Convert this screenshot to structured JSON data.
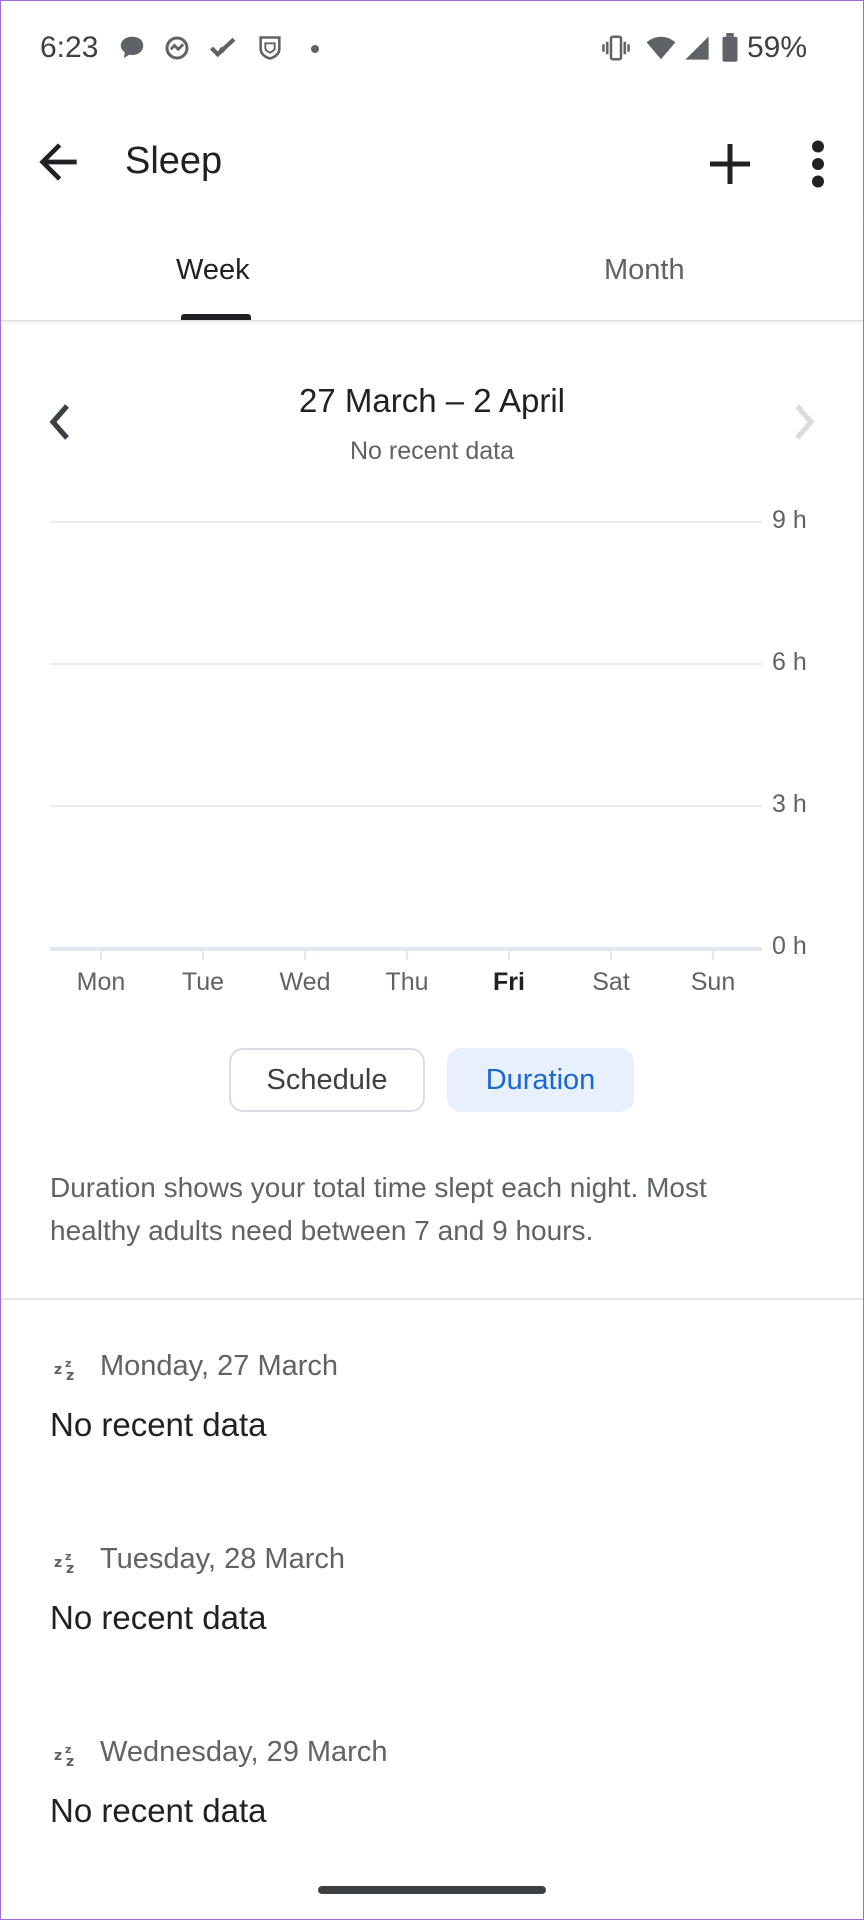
{
  "status_bar": {
    "time": "6:23",
    "battery": "59%",
    "icons": [
      "chat-icon",
      "fitness-icon",
      "tasks-icon",
      "shield-icon",
      "dot-icon",
      "vibrate-icon",
      "wifi-icon",
      "signal-icon",
      "battery-icon"
    ]
  },
  "app_bar": {
    "title": "Sleep",
    "icons": [
      "back-arrow-icon",
      "add-icon",
      "more-vert-icon"
    ]
  },
  "tabs": [
    {
      "label": "Week",
      "selected": true
    },
    {
      "label": "Month",
      "selected": false
    }
  ],
  "range": {
    "title": "27 March – 2 April",
    "subtitle": "No recent data"
  },
  "chart_data": {
    "type": "bar",
    "categories": [
      "Mon",
      "Tue",
      "Wed",
      "Thu",
      "Fri",
      "Sat",
      "Sun"
    ],
    "highlighted_category": "Fri",
    "values": [
      null,
      null,
      null,
      null,
      null,
      null,
      null
    ],
    "y_ticks": [
      "9 h",
      "6 h",
      "3 h",
      "0 h"
    ],
    "ylim": [
      0,
      9
    ],
    "grid": true,
    "y_axis_side": "right"
  },
  "segments": {
    "schedule": "Schedule",
    "duration": "Duration",
    "selected": "Duration"
  },
  "description": "Duration shows your total time slept each night. Most healthy adults need between 7 and 9 hours.",
  "days": [
    {
      "date": "Monday, 27 March",
      "value": "No recent data"
    },
    {
      "date": "Tuesday, 28 March",
      "value": "No recent data"
    },
    {
      "date": "Wednesday, 29 March",
      "value": "No recent data"
    }
  ],
  "colors": {
    "accent": "#1967d2",
    "accent_bg": "#e8f0fe",
    "text_primary": "#202124",
    "text_secondary": "#5f6368"
  }
}
